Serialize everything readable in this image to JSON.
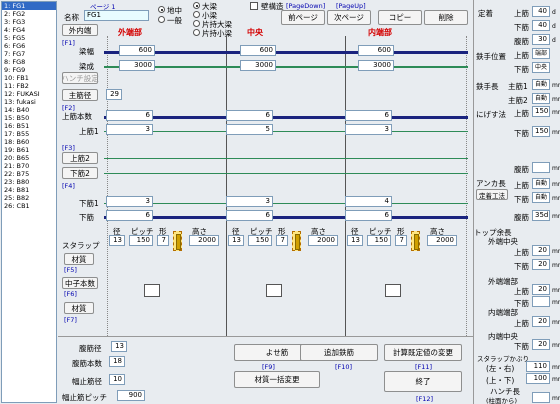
{
  "list": [
    "1: FG1",
    "2: FG2",
    "3: FG3",
    "4: FG4",
    "5: FG5",
    "6: FG6",
    "7: FG7",
    "8: FG8",
    "9: FG9",
    "10: FB1",
    "11: FB2",
    "12: FUKASI",
    "13: fukasi",
    "14: B40",
    "15: B50",
    "16: B51",
    "17: B55",
    "18: B60",
    "19: B61",
    "20: B65",
    "21: B70",
    "22: B75",
    "23: B80",
    "24: B81",
    "25: B82",
    "26: CB1"
  ],
  "header": {
    "name_label": "名称",
    "name_value": "FG1",
    "page_label": "ページ 1",
    "radio1": "地中",
    "radio2": "一般",
    "radio3": "大梁",
    "radio4": "小梁",
    "radio5": "片持大梁",
    "radio6": "片持小梁",
    "wall_label": "壁構造",
    "hint_prev": "[PageDown]",
    "hint_next": "[PageUp]",
    "prev_btn": "前ページ",
    "next_btn": "次ページ",
    "copy_btn": "コピー",
    "del_btn": "削除",
    "inout_btn": "外内端",
    "sec_outer": "外端部",
    "sec_center": "中央",
    "sec_inner": "内端部"
  },
  "rows": {
    "f1": "[F1]",
    "beam_width": "梁幅",
    "beam_depth": "梁成",
    "haunch_btn": "ハンチ設定",
    "main_dia_btn": "主筋径",
    "main_dia_val": "29",
    "f2": "[F2]",
    "top_count": "上筋本数",
    "top1": "上筋1",
    "f3": "[F3]",
    "top2_btn": "上筋2",
    "bottom2_btn": "下筋2",
    "f4": "[F4]",
    "bottom1": "下筋1",
    "bottom": "下筋",
    "stirrup": "スタラップ",
    "dia_label": "径",
    "pitch_label": "ピッチ",
    "shape_label": "形",
    "height_label": "高さ",
    "material_btn": "材質",
    "f5": "[F5]",
    "center_count_btn": "中子本数",
    "f6": "[F6]",
    "material2_btn": "材質",
    "f7": "[F7]"
  },
  "outer": {
    "width": "600",
    "depth": "3000",
    "count": "6",
    "top1": "3",
    "bottom1": "3",
    "bottom": "6",
    "dia": "13",
    "pitch": "150",
    "shape": "7",
    "height": "2000"
  },
  "center": {
    "width": "600",
    "depth": "3000",
    "count": "6",
    "top1": "5",
    "bottom1": "3",
    "bottom": "6",
    "dia": "13",
    "pitch": "150",
    "shape": "7",
    "height": "2000"
  },
  "inner": {
    "width": "600",
    "depth": "3000",
    "count": "6",
    "top1": "3",
    "bottom1": "4",
    "bottom": "6",
    "dia": "13",
    "pitch": "150",
    "shape": "7",
    "height": "2000"
  },
  "bottom_panel": {
    "rib_dia_label": "腹筋径",
    "rib_dia": "13",
    "rib_count_label": "腹筋本数",
    "rib_count": "18",
    "stop_dia_label": "幅止筋径",
    "stop_dia": "10",
    "stop_pitch_label": "幅止筋ピッチ",
    "stop_pitch": "900",
    "yose_btn": "よせ筋",
    "f9": "[F9]",
    "add_btn": "追加鉄筋",
    "f10": "[F10]",
    "calc_btn": "計算既定値の変更",
    "f11": "[F11]",
    "mat_all_btn": "材質一括変更",
    "end_btn": "終了",
    "f12": "[F12]"
  },
  "right": {
    "teichaku": "定着",
    "top_bar": "上筋",
    "top_val": "40",
    "bottom_bar": "下筋",
    "bottom_val": "40",
    "rib_bar": "腹筋",
    "rib_val": "30",
    "kaeshi": "鉄手位置",
    "kaeshi_top": "上筋",
    "kaeshi_top_val": "端部",
    "kaeshi_bot": "下筋",
    "kaeshi_bot_val": "中央",
    "tesu": "鉄手長",
    "main1": "主筋1",
    "main1_val": "自動",
    "main2": "主筋2",
    "main2_val": "自動",
    "nigeshi": "にげす法",
    "n_top": "上筋",
    "n_top_val": "150",
    "n_bot": "下筋",
    "n_bot_val": "150",
    "n_rib": "腹筋",
    "anchor": "アンカ長",
    "teian_btn": "定着工法",
    "a_top": "上筋",
    "a_top_val": "自動",
    "a_bot": "下筋",
    "a_bot_val": "自動",
    "a_rib": "腹筋",
    "a_rib_val": "35d",
    "top_ext": "トップ余長",
    "s_center": "外端中央",
    "s_top_val": "20",
    "s_bot_val": "20",
    "outer_end": "外端端部",
    "inner_end": "内端端部",
    "inner_center": "内端中央",
    "ue": "上筋",
    "shita": "下筋",
    "d20": "20",
    "stirrup_cover": "スタラップかぶり",
    "lr": "(左・右)",
    "lr_val": "110",
    "ud": "(上・下)",
    "ud_val": "100",
    "haunch_len": "ハンチ長",
    "haunch_sub": "(柱面から)",
    "mm": "mm"
  },
  "colors": {
    "selected": "#316ac5",
    "beam": "#1a237e",
    "teal": "#2e8b57",
    "red": "#d40000"
  }
}
